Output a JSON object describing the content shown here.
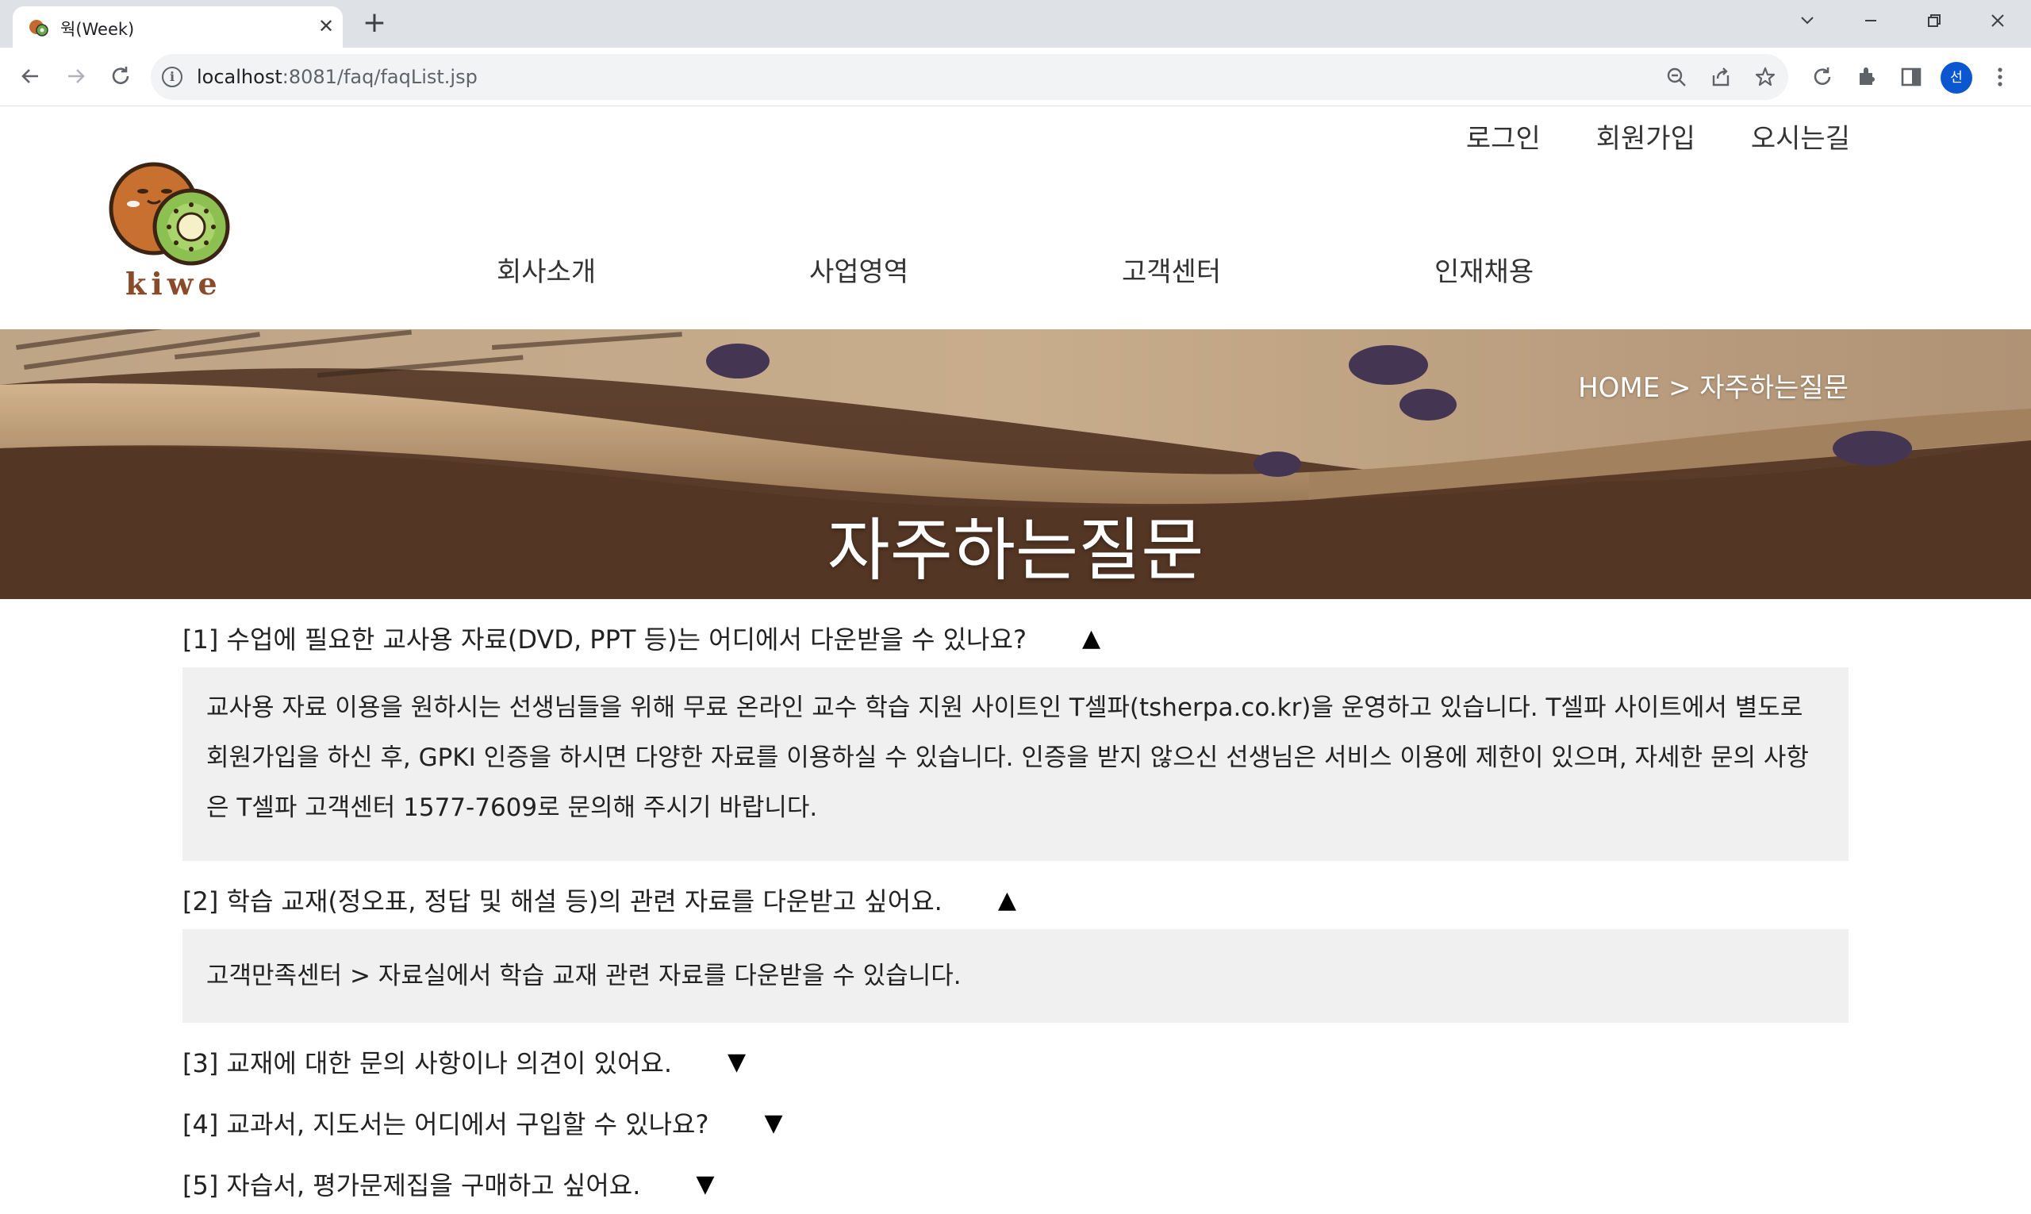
{
  "browser": {
    "tab_title": "웍(Week)",
    "tab_close": "✕",
    "new_tab": "+",
    "url_host": "localhost",
    "url_path": ":8081/faq/faqList.jsp",
    "profile_initial": "선",
    "window_controls": {
      "minimize": "—",
      "restore": "❐",
      "close": "✕",
      "tab_search": "⌄"
    }
  },
  "header": {
    "top_links": [
      "로그인",
      "회원가입",
      "오시는길"
    ],
    "logo_text": "kiwe",
    "nav": [
      "회사소개",
      "사업영역",
      "고객센터",
      "인재채용"
    ]
  },
  "hero": {
    "breadcrumb": "HOME > 자주하는질문",
    "title": "자주하는질문"
  },
  "faq": [
    {
      "question": "[1] 수업에 필요한 교사용 자료(DVD, PPT 등)는 어디에서 다운받을 수 있나요?",
      "arrow": "▲",
      "answer": "교사용 자료 이용을 원하시는 선생님들을 위해 무료 온라인 교수 학습 지원 사이트인 T셀파(tsherpa.co.kr)을 운영하고 있습니다. T셀파 사이트에서 별도로 회원가입을 하신 후, GPKI 인증을 하시면 다양한 자료를 이용하실 수 있습니다. 인증을 받지 않으신 선생님은 서비스 이용에 제한이 있으며, 자세한 문의 사항은 T셀파 고객센터 1577-7609로 문의해 주시기 바랍니다."
    },
    {
      "question": "[2] 학습 교재(정오표, 정답 및 해설 등)의 관련 자료를 다운받고 싶어요.",
      "arrow": "▲",
      "answer": "고객만족센터 > 자료실에서 학습 교재 관련 자료를 다운받을 수 있습니다."
    },
    {
      "question": "[3] 교재에 대한 문의 사항이나 의견이 있어요.",
      "arrow": "▼"
    },
    {
      "question": "[4] 교과서, 지도서는 어디에서 구입할 수 있나요?",
      "arrow": "▼"
    },
    {
      "question": "[5] 자습서, 평가문제집을 구매하고 싶어요.",
      "arrow": "▼"
    }
  ]
}
